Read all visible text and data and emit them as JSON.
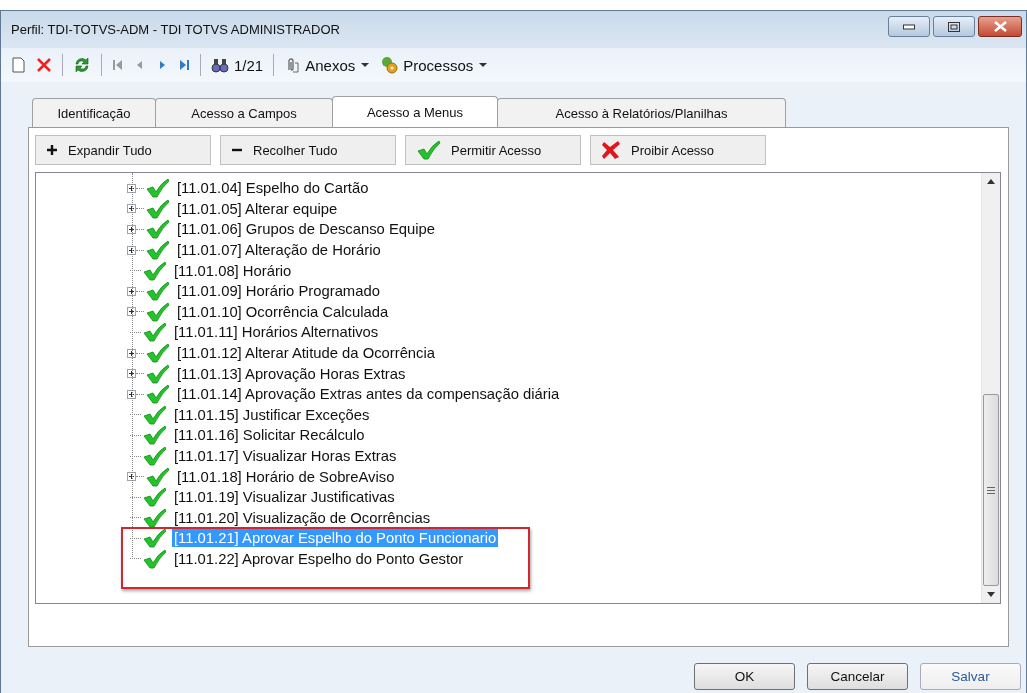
{
  "window": {
    "title": "Perfil: TDI-TOTVS-ADM - TDI TOTVS ADMINISTRADOR"
  },
  "toolbar": [
    {
      "kind": "new"
    },
    {
      "kind": "delete"
    },
    {
      "kind": "sep"
    },
    {
      "kind": "refresh"
    },
    {
      "kind": "sep"
    },
    {
      "kind": "first"
    },
    {
      "kind": "prev"
    },
    {
      "kind": "next"
    },
    {
      "kind": "last"
    },
    {
      "kind": "sep"
    },
    {
      "kind": "find",
      "text": "1/21"
    },
    {
      "kind": "sep"
    },
    {
      "kind": "attach",
      "text": "Anexos",
      "dropdown": true
    },
    {
      "kind": "process",
      "text": "Processos",
      "dropdown": true
    }
  ],
  "tabs": [
    {
      "label": "Identificação",
      "selected": false
    },
    {
      "label": "Acesso a Campos",
      "selected": false
    },
    {
      "label": "Acesso a Menus",
      "selected": true
    },
    {
      "label": "Acesso à Relatórios/Planilhas",
      "selected": false
    }
  ],
  "actions": [
    {
      "kind": "plus",
      "label": "Expandir Tudo"
    },
    {
      "kind": "minus",
      "label": "Recolher Tudo"
    },
    {
      "kind": "check",
      "label": "Permitir Acesso"
    },
    {
      "kind": "cross",
      "label": "Proibir Acesso"
    }
  ],
  "tree": {
    "items": [
      {
        "label": "[11.01.04] Espelho do Cartão",
        "expandable": true,
        "allowed": true,
        "selected": false,
        "boxed": false
      },
      {
        "label": "[11.01.05] Alterar equipe",
        "expandable": true,
        "allowed": true,
        "selected": false,
        "boxed": false
      },
      {
        "label": "[11.01.06] Grupos de Descanso Equipe",
        "expandable": true,
        "allowed": true,
        "selected": false,
        "boxed": false
      },
      {
        "label": "[11.01.07] Alteração de Horário",
        "expandable": true,
        "allowed": true,
        "selected": false,
        "boxed": false
      },
      {
        "label": "[11.01.08] Horário",
        "expandable": false,
        "allowed": true,
        "selected": false,
        "boxed": false
      },
      {
        "label": "[11.01.09] Horário Programado",
        "expandable": true,
        "allowed": true,
        "selected": false,
        "boxed": false
      },
      {
        "label": "[11.01.10] Ocorrência Calculada",
        "expandable": true,
        "allowed": true,
        "selected": false,
        "boxed": false
      },
      {
        "label": "[11.01.11] Horários Alternativos",
        "expandable": false,
        "allowed": true,
        "selected": false,
        "boxed": false
      },
      {
        "label": "[11.01.12] Alterar Atitude da Ocorrência",
        "expandable": true,
        "allowed": true,
        "selected": false,
        "boxed": false
      },
      {
        "label": "[11.01.13] Aprovação Horas Extras",
        "expandable": true,
        "allowed": true,
        "selected": false,
        "boxed": false
      },
      {
        "label": "[11.01.14] Aprovação Extras antes da compensação diária",
        "expandable": true,
        "allowed": true,
        "selected": false,
        "boxed": false
      },
      {
        "label": "[11.01.15] Justificar Exceções",
        "expandable": false,
        "allowed": true,
        "selected": false,
        "boxed": false
      },
      {
        "label": "[11.01.16] Solicitar Recálculo",
        "expandable": false,
        "allowed": true,
        "selected": false,
        "boxed": false
      },
      {
        "label": "[11.01.17] Visualizar Horas Extras",
        "expandable": false,
        "allowed": true,
        "selected": false,
        "boxed": false
      },
      {
        "label": "[11.01.18] Horário de SobreAviso",
        "expandable": true,
        "allowed": true,
        "selected": false,
        "boxed": false
      },
      {
        "label": "[11.01.19] Visualizar Justificativas",
        "expandable": false,
        "allowed": true,
        "selected": false,
        "boxed": false
      },
      {
        "label": "[11.01.20] Visualização de Ocorrências",
        "expandable": false,
        "allowed": true,
        "selected": false,
        "boxed": false
      },
      {
        "label": "[11.01.21] Aprovar Espelho do Ponto Funcionario",
        "expandable": false,
        "allowed": true,
        "selected": true,
        "boxed": true
      },
      {
        "label": "[11.01.22] Aprovar Espelho do Ponto Gestor",
        "expandable": false,
        "allowed": true,
        "selected": false,
        "boxed": true
      }
    ]
  },
  "footer": [
    {
      "label": "OK",
      "kind": "normal"
    },
    {
      "label": "Cancelar",
      "kind": "normal"
    },
    {
      "label": "Salvar",
      "kind": "default"
    }
  ]
}
